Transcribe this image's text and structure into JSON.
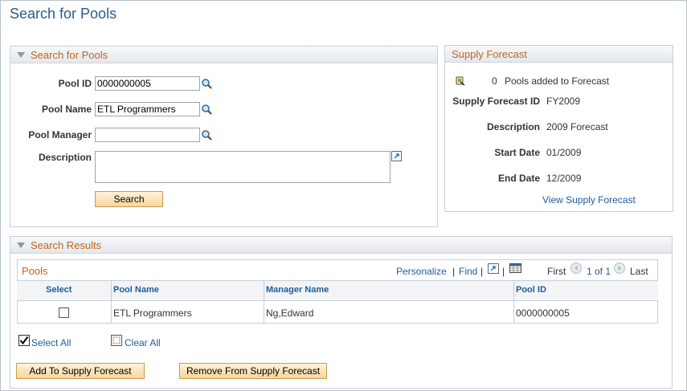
{
  "page": {
    "title": "Search for Pools"
  },
  "search_panel": {
    "header": "Search for Pools",
    "pool_id_label": "Pool ID",
    "pool_id_value": "0000000005",
    "pool_name_label": "Pool Name",
    "pool_name_value": "ETL Programmers",
    "pool_manager_label": "Pool Manager",
    "pool_manager_value": "",
    "description_label": "Description",
    "description_value": "",
    "search_button": "Search"
  },
  "forecast_panel": {
    "header": "Supply Forecast",
    "count": "0",
    "count_text": "Pools added to Forecast",
    "id_label": "Supply Forecast ID",
    "id_value": "FY2009",
    "description_label": "Description",
    "description_value": "2009 Forecast",
    "start_label": "Start Date",
    "start_value": "01/2009",
    "end_label": "End Date",
    "end_value": "12/2009",
    "view_link": "View Supply Forecast"
  },
  "results_panel": {
    "header": "Search Results",
    "grid_title": "Pools",
    "personalize": "Personalize",
    "find": "Find",
    "first": "First",
    "range": "1 of 1",
    "last": "Last",
    "columns": [
      "Select",
      "Pool Name",
      "Manager Name",
      "Pool ID"
    ],
    "rows": [
      {
        "pool_name": "ETL Programmers",
        "manager": "Ng,Edward",
        "pool_id": "0000000005"
      }
    ],
    "select_all": "Select All",
    "clear_all": "Clear All",
    "add_button": "Add To Supply Forecast",
    "remove_button": "Remove From Supply Forecast"
  },
  "colors": {
    "title": "#2a5a8c",
    "section_header": "#c0651b",
    "link": "#1f5c99"
  },
  "icons": [
    "lookup-icon",
    "expand-icon",
    "forecast-icon",
    "download-icon",
    "grid-view-icon",
    "prev-arrow-icon",
    "next-arrow-icon"
  ]
}
